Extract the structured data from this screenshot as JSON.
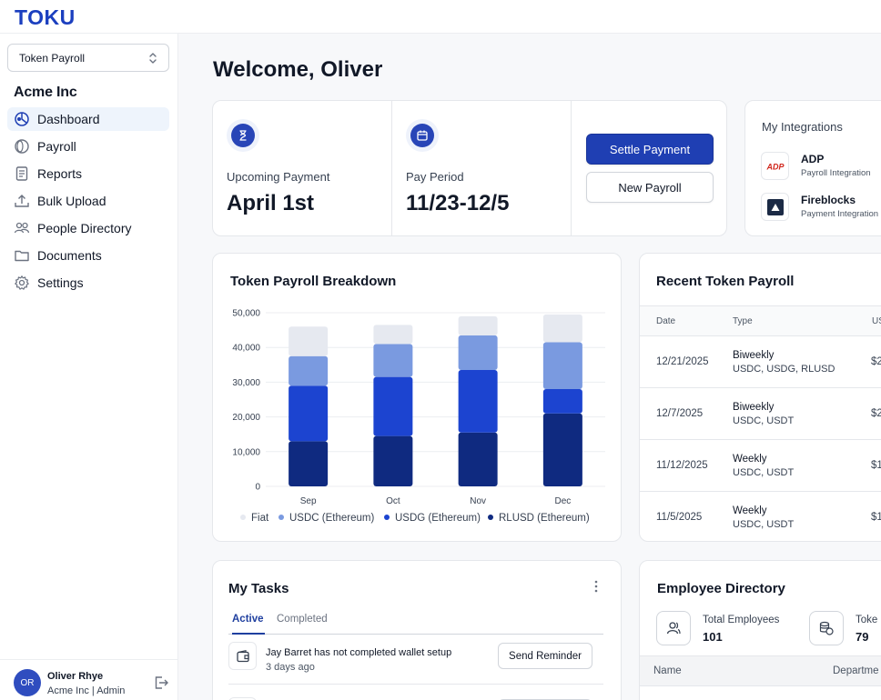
{
  "brand": {
    "logo": "TOKU",
    "accent": "#1f3fb3"
  },
  "sidebar": {
    "selector": "Token Payroll",
    "org": "Acme Inc",
    "items": [
      {
        "label": "Dashboard",
        "icon": "dashboard-icon",
        "active": true
      },
      {
        "label": "Payroll",
        "icon": "coin-icon"
      },
      {
        "label": "Reports",
        "icon": "report-icon"
      },
      {
        "label": "Bulk Upload",
        "icon": "upload-icon"
      },
      {
        "label": "People Directory",
        "icon": "people-icon"
      },
      {
        "label": "Documents",
        "icon": "folder-icon"
      },
      {
        "label": "Settings",
        "icon": "gear-icon"
      }
    ],
    "user": {
      "initials": "OR",
      "name": "Oliver Rhye",
      "role": "Acme Inc | Admin"
    }
  },
  "main": {
    "welcome": "Welcome, Oliver",
    "summary": {
      "upcoming_label": "Upcoming Payment",
      "upcoming_value": "April 1st",
      "period_label": "Pay Period",
      "period_value": "11/23-12/5",
      "settle_button": "Settle Payment",
      "new_payroll_button": "New Payroll"
    },
    "integrations": {
      "title": "My Integrations",
      "items": [
        {
          "name": "ADP",
          "sub": "Payroll Integration",
          "icon": "adp-logo"
        },
        {
          "name": "Fireblocks",
          "sub": "Payment Integration",
          "icon": "fireblocks-logo"
        }
      ]
    },
    "breakdown_title": "Token Payroll Breakdown",
    "recent": {
      "title": "Recent Token Payroll",
      "columns": [
        "Date",
        "Type",
        "US"
      ],
      "rows": [
        {
          "date": "12/21/2025",
          "type": "Biweekly",
          "currencies": "USDC, USDG, RLUSD",
          "amount": "$2"
        },
        {
          "date": "12/7/2025",
          "type": "Biweekly",
          "currencies": "USDC, USDT",
          "amount": "$2"
        },
        {
          "date": "11/12/2025",
          "type": "Weekly",
          "currencies": "USDC, USDT",
          "amount": "$1"
        },
        {
          "date": "11/5/2025",
          "type": "Weekly",
          "currencies": "USDC, USDT",
          "amount": "$1"
        }
      ]
    },
    "tasks": {
      "title": "My Tasks",
      "tabs": [
        "Active",
        "Completed"
      ],
      "items": [
        {
          "title": "Jay Barret has not completed wallet setup",
          "sub": "3 days ago",
          "button": "Send Reminder"
        }
      ]
    },
    "directory": {
      "title": "Employee Directory",
      "total_label": "Total Employees",
      "total_value": "101",
      "token_label": "Toke",
      "token_value": "79",
      "columns": [
        "Name",
        "Departme"
      ]
    }
  },
  "chart_data": {
    "type": "bar",
    "stacked": true,
    "categories": [
      "Sep",
      "Oct",
      "Nov",
      "Dec"
    ],
    "series": [
      {
        "name": "RLUSD (Ethereum)",
        "color": "#0f2a80",
        "values": [
          13000,
          14500,
          15500,
          21000
        ]
      },
      {
        "name": "USDG (Ethereum)",
        "color": "#1c44d0",
        "values": [
          16000,
          17000,
          18000,
          7000
        ]
      },
      {
        "name": "USDC (Ethereum)",
        "color": "#7a9ae0",
        "values": [
          8500,
          9500,
          10000,
          13500
        ]
      },
      {
        "name": "Fiat",
        "color": "#e6e9f0",
        "values": [
          8500,
          5500,
          5500,
          8000
        ]
      }
    ],
    "legend_order": [
      "Fiat",
      "USDC (Ethereum)",
      "USDG (Ethereum)",
      "RLUSD (Ethereum)"
    ],
    "yticks": [
      "50,000",
      "40,000",
      "30,000",
      "20,000",
      "10,000",
      "0"
    ],
    "ylim": [
      0,
      50000
    ],
    "grid": true,
    "legend_position": "bottom"
  }
}
